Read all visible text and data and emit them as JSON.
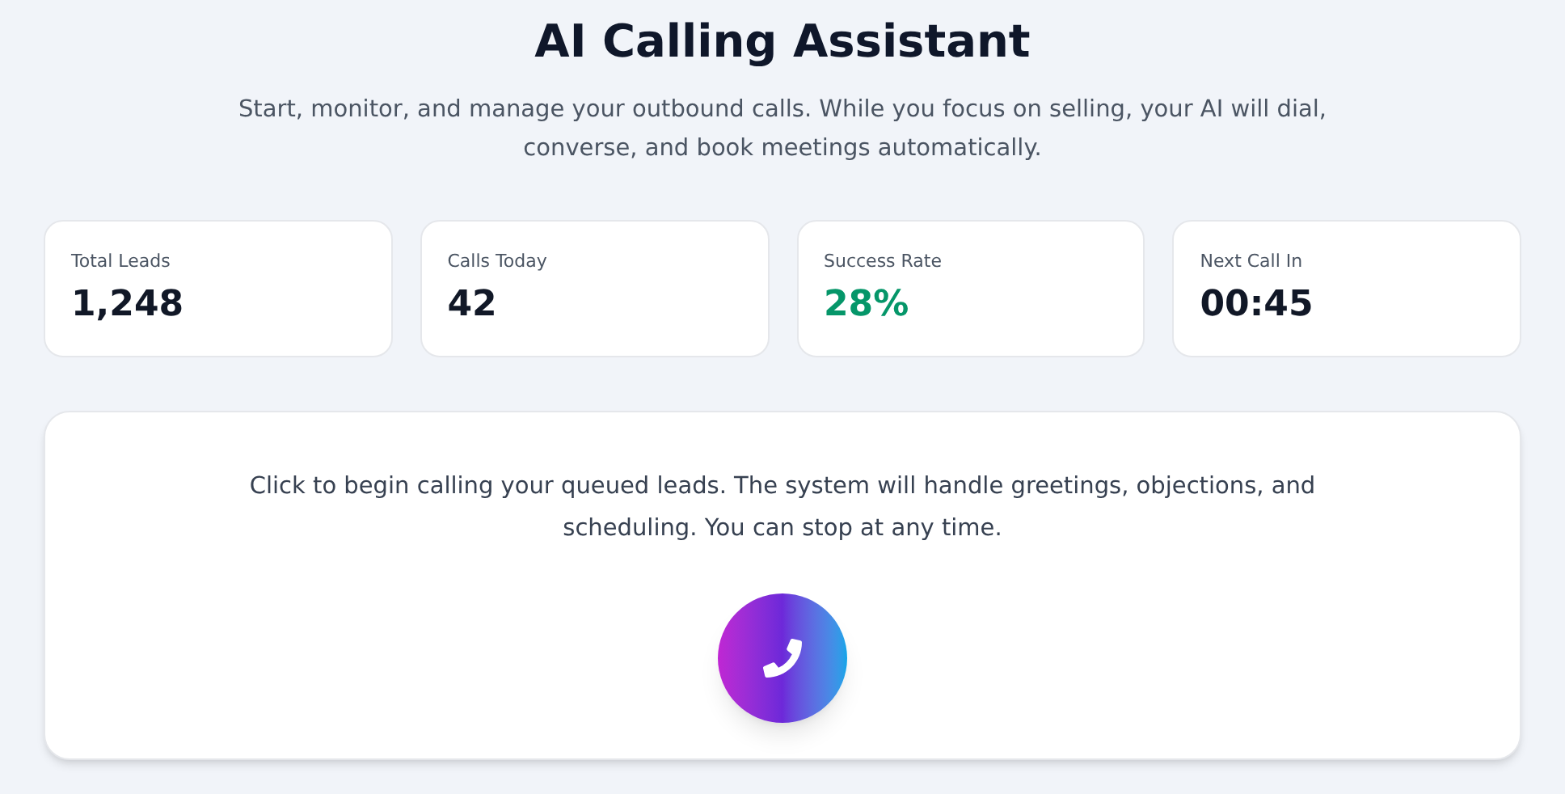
{
  "header": {
    "title": "AI Calling Assistant",
    "subtitle": "Start, monitor, and manage your outbound calls. While you focus on selling, your AI will dial, converse, and book meetings automatically."
  },
  "stats": [
    {
      "label": "Total Leads",
      "value": "1,248",
      "color": "#111827"
    },
    {
      "label": "Calls Today",
      "value": "42",
      "color": "#111827"
    },
    {
      "label": "Success Rate",
      "value": "28%",
      "color": "#059669"
    },
    {
      "label": "Next Call In",
      "value": "00:45",
      "color": "#111827"
    }
  ],
  "call_panel": {
    "description": "Click to begin calling your queued leads. The system will handle greetings, objections, and scheduling. You can stop at any time."
  }
}
